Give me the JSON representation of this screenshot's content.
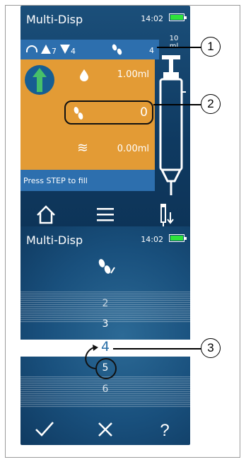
{
  "screen1": {
    "title": "Multi-Disp",
    "time": "14:02",
    "infobar": {
      "up_value": "7",
      "down_value": "4",
      "steps_value": "4"
    },
    "dispense_volume": "1.00ml",
    "step_count": "0",
    "remaining_volume": "0.00ml",
    "syringe_volume": "10",
    "syringe_unit": "ml",
    "prompt": "Press STEP to fill",
    "nav_icons": [
      "home-icon",
      "menu-icon",
      "pipette-icon"
    ]
  },
  "screen2": {
    "title": "Multi-Disp",
    "time": "14:02",
    "roller": {
      "above2": "2",
      "above1": "3",
      "selected": "4",
      "below1": "5",
      "below2": "6"
    },
    "nav_icons": [
      "check-icon",
      "close-icon",
      "help-icon"
    ]
  },
  "callouts": [
    "1",
    "2",
    "3"
  ],
  "colors": {
    "accent_orange": "#e39b35",
    "bar_blue": "#2d6fae",
    "battery_green": "#2ee43a"
  }
}
